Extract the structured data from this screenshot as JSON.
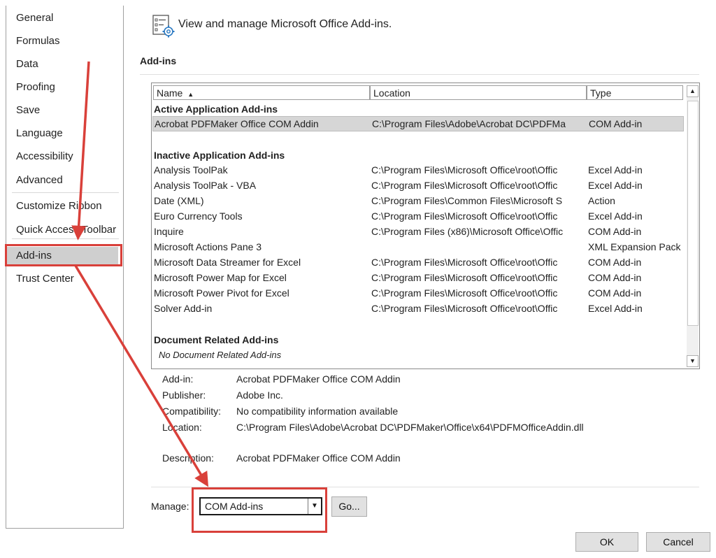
{
  "nav": {
    "items": [
      "General",
      "Formulas",
      "Data",
      "Proofing",
      "Save",
      "Language",
      "Accessibility",
      "Advanced",
      "Customize Ribbon",
      "Quick Access Toolbar",
      "Add-ins",
      "Trust Center"
    ],
    "selected": "Add-ins"
  },
  "header": {
    "icon": "addins-settings-icon",
    "text": "View and manage Microsoft Office Add-ins."
  },
  "section": {
    "title": "Add-ins"
  },
  "list": {
    "columns": {
      "name": "Name",
      "sort_glyph": "▲",
      "location": "Location",
      "type": "Type"
    },
    "active_group": "Active Application Add-ins",
    "active": [
      {
        "name": "Acrobat PDFMaker Office COM Addin",
        "location": "C:\\Program Files\\Adobe\\Acrobat DC\\PDFMa",
        "type": "COM Add-in"
      }
    ],
    "inactive_group": "Inactive Application Add-ins",
    "inactive": [
      {
        "name": "Analysis ToolPak",
        "location": "C:\\Program Files\\Microsoft Office\\root\\Offic",
        "type": "Excel Add-in"
      },
      {
        "name": "Analysis ToolPak - VBA",
        "location": "C:\\Program Files\\Microsoft Office\\root\\Offic",
        "type": "Excel Add-in"
      },
      {
        "name": "Date (XML)",
        "location": "C:\\Program Files\\Common Files\\Microsoft S",
        "type": "Action"
      },
      {
        "name": "Euro Currency Tools",
        "location": "C:\\Program Files\\Microsoft Office\\root\\Offic",
        "type": "Excel Add-in"
      },
      {
        "name": "Inquire",
        "location": "C:\\Program Files (x86)\\Microsoft Office\\Offic",
        "type": "COM Add-in"
      },
      {
        "name": "Microsoft Actions Pane 3",
        "location": "",
        "type": "XML Expansion Pack"
      },
      {
        "name": "Microsoft Data Streamer for Excel",
        "location": "C:\\Program Files\\Microsoft Office\\root\\Offic",
        "type": "COM Add-in"
      },
      {
        "name": "Microsoft Power Map for Excel",
        "location": "C:\\Program Files\\Microsoft Office\\root\\Offic",
        "type": "COM Add-in"
      },
      {
        "name": "Microsoft Power Pivot for Excel",
        "location": "C:\\Program Files\\Microsoft Office\\root\\Offic",
        "type": "COM Add-in"
      },
      {
        "name": "Solver Add-in",
        "location": "C:\\Program Files\\Microsoft Office\\root\\Offic",
        "type": "Excel Add-in"
      }
    ],
    "document_group": "Document Related Add-ins",
    "document_none": "No Document Related Add-ins",
    "scroll_up": "▲",
    "scroll_down": "▼"
  },
  "details": {
    "addin_label": "Add-in:",
    "addin_value": "Acrobat PDFMaker Office COM Addin",
    "publisher_label": "Publisher:",
    "publisher_value": "Adobe Inc.",
    "compat_label": "Compatibility:",
    "compat_value": "No compatibility information available",
    "location_label": "Location:",
    "location_value": "C:\\Program Files\\Adobe\\Acrobat DC\\PDFMaker\\Office\\x64\\PDFMOfficeAddin.dll",
    "desc_label": "Description:",
    "desc_value": "Acrobat PDFMaker Office COM Addin"
  },
  "manage": {
    "label": "Manage:",
    "selected": "COM Add-ins",
    "dropdown_glyph": "▼",
    "go": "Go..."
  },
  "buttons": {
    "ok": "OK",
    "cancel": "Cancel"
  },
  "colors": {
    "highlight": "#d9403a",
    "selection": "#cfcfcf"
  }
}
